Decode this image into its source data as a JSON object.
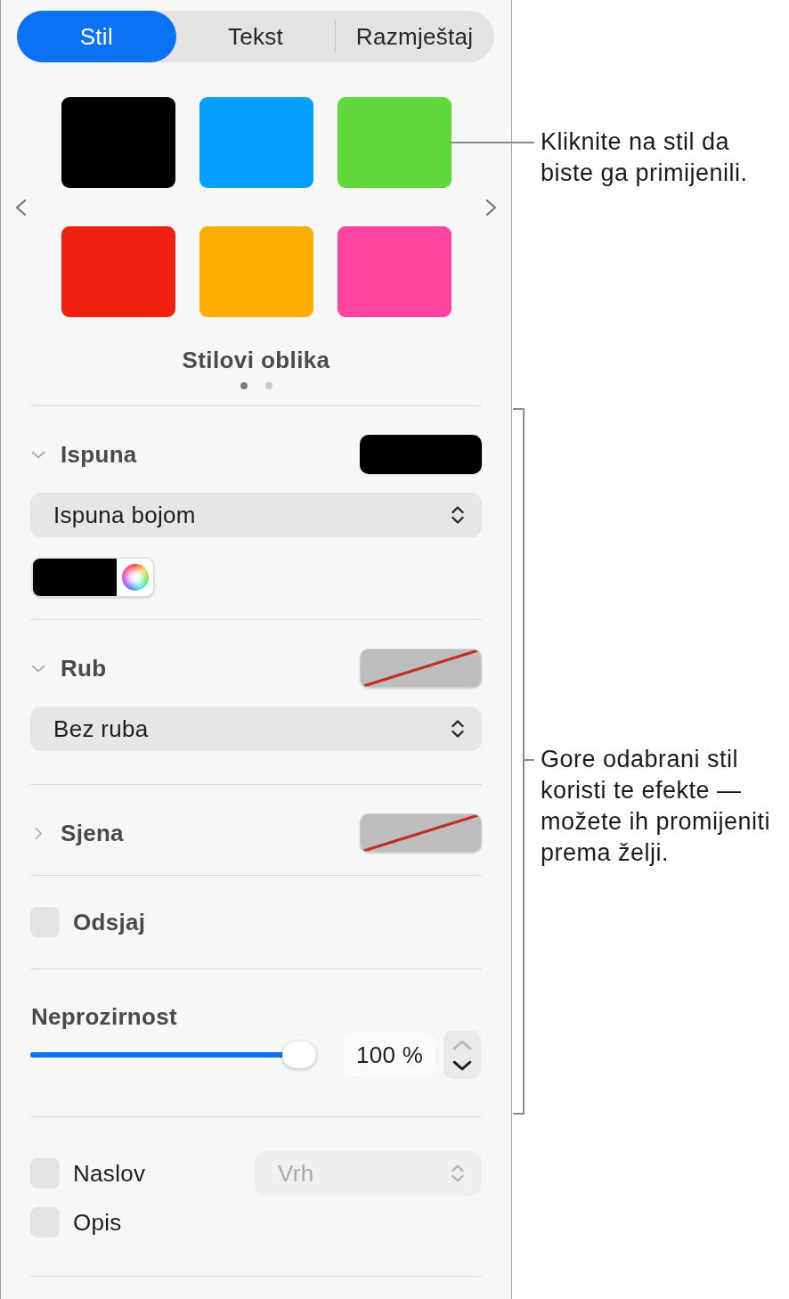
{
  "tabs": [
    {
      "label": "Stil",
      "selected": true
    },
    {
      "label": "Tekst",
      "selected": false
    },
    {
      "label": "Razmještaj",
      "selected": false
    }
  ],
  "styles": {
    "swatches": [
      {
        "color": "#000000"
      },
      {
        "color": "#05a0ff"
      },
      {
        "color": "#5fd93a"
      },
      {
        "color": "#ef2211"
      },
      {
        "color": "#ffad00"
      },
      {
        "color": "#ff44a0"
      }
    ],
    "title": "Stilovi oblika",
    "pages": [
      {
        "selected": true
      },
      {
        "selected": false
      }
    ]
  },
  "sections": [
    {
      "kind": "disclosure",
      "title": "Ispuna",
      "expanded": true,
      "well": {
        "kind": "color",
        "color": "#000000"
      },
      "popup": {
        "value": "Ispuna bojom",
        "disabled": false
      },
      "color_picker": {
        "color": "#000000"
      }
    },
    {
      "kind": "disclosure",
      "title": "Rub",
      "expanded": true,
      "well": {
        "kind": "none"
      },
      "popup": {
        "value": "Bez ruba",
        "disabled": false
      }
    },
    {
      "kind": "disclosure",
      "title": "Sjena",
      "expanded": false,
      "well": {
        "kind": "none"
      }
    },
    {
      "kind": "checkbox",
      "label": "Odsjaj",
      "checked": false
    },
    {
      "kind": "slider",
      "title": "Neprozirnost",
      "level": 1,
      "value": "100 %",
      "stepper": {
        "up_disabled": true,
        "down_disabled": false
      }
    },
    {
      "kind": "options",
      "items": [
        {
          "label": "Naslov",
          "checked": false,
          "popup": {
            "value": "Vrh",
            "disabled": true
          }
        },
        {
          "label": "Opis",
          "checked": false
        }
      ]
    }
  ],
  "callouts": [
    {
      "kind": "leader",
      "lines": [
        "Kliknite na stil da",
        "biste ga primijenili."
      ]
    },
    {
      "kind": "bracket",
      "lines": [
        "Gore odabrani stil",
        "koristi te efekte —",
        "možete ih promijeniti",
        "prema želji."
      ]
    }
  ]
}
